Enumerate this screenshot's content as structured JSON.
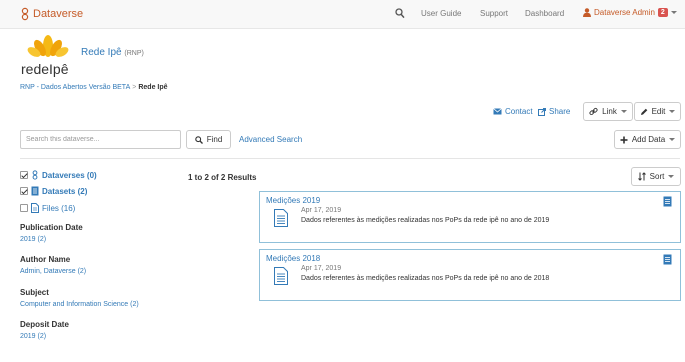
{
  "navbar": {
    "brand": "Dataverse",
    "items": [
      "User Guide",
      "Support",
      "Dashboard"
    ],
    "user": "Dataverse Admin",
    "notifications": "2"
  },
  "header": {
    "logo_text": "redeIpê",
    "dataverse_name": "Rede Ipê",
    "affiliation": "(RNP)"
  },
  "breadcrumb": {
    "parent": "RNP - Dados Abertos Versão BETA",
    "separator": ">",
    "current": "Rede Ipê"
  },
  "actions": {
    "contact": "Contact",
    "share": "Share",
    "link": "Link",
    "edit": "Edit",
    "add_data": "Add Data"
  },
  "search": {
    "placeholder": "Search this dataverse...",
    "find": "Find",
    "advanced": "Advanced Search"
  },
  "types": [
    {
      "label": "Dataverses (0)",
      "checked": true
    },
    {
      "label": "Datasets (2)",
      "checked": true
    },
    {
      "label": "Files (16)",
      "checked": false
    }
  ],
  "facets": [
    {
      "title": "Publication Date",
      "value": "2019 (2)"
    },
    {
      "title": "Author Name",
      "value": "Admin, Dataverse (2)"
    },
    {
      "title": "Subject",
      "value": "Computer and Information Science (2)"
    },
    {
      "title": "Deposit Date",
      "value": "2019 (2)"
    }
  ],
  "results": {
    "count": "1 to 2 of 2 Results",
    "sort": "Sort",
    "items": [
      {
        "title": "Medições 2019",
        "date": "Apr 17, 2019",
        "description": "Dados referentes às medições realizadas nos PoPs da rede ipê no ano de 2019"
      },
      {
        "title": "Medições 2018",
        "date": "Apr 17, 2019",
        "description": "Dados referentes às medições realizadas nos PoPs da rede ipê no ano de 2018"
      }
    ]
  },
  "colors": {
    "brand": "#c55b28",
    "link": "#337ab7",
    "card_border": "#90c0d9",
    "badge": "#d9534f"
  }
}
